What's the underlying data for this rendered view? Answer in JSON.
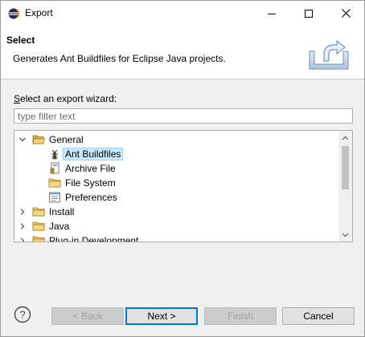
{
  "window": {
    "title": "Export",
    "controls": {
      "minimize": "minimize",
      "maximize": "maximize",
      "close": "close"
    }
  },
  "banner": {
    "title": "Select",
    "description": "Generates Ant Buildfiles for Eclipse Java projects."
  },
  "content": {
    "wizard_label_prefix": "S",
    "wizard_label_rest": "elect an export wizard:",
    "filter": {
      "placeholder": "type filter text",
      "value": ""
    }
  },
  "tree": {
    "items": [
      {
        "label": "General",
        "level": 0,
        "expanded": true,
        "icon": "folder-open-icon"
      },
      {
        "label": "Ant Buildfiles",
        "level": 1,
        "selected": true,
        "icon": "ant-icon"
      },
      {
        "label": "Archive File",
        "level": 1,
        "icon": "archive-icon"
      },
      {
        "label": "File System",
        "level": 1,
        "icon": "folder-icon"
      },
      {
        "label": "Preferences",
        "level": 1,
        "icon": "preferences-icon"
      },
      {
        "label": "Install",
        "level": 0,
        "expanded": false,
        "icon": "folder-icon"
      },
      {
        "label": "Java",
        "level": 0,
        "expanded": false,
        "icon": "folder-icon"
      },
      {
        "label": "Plug-in Development",
        "level": 0,
        "expanded": false,
        "icon": "folder-icon"
      }
    ]
  },
  "buttons": {
    "help": "?",
    "back": "< Back",
    "next": "Next >",
    "finish": "Finish",
    "cancel": "Cancel"
  },
  "colors": {
    "selection_bg": "#cce8ff",
    "default_button_border": "#0078d7",
    "folder_yellow": "#e8b84a"
  }
}
